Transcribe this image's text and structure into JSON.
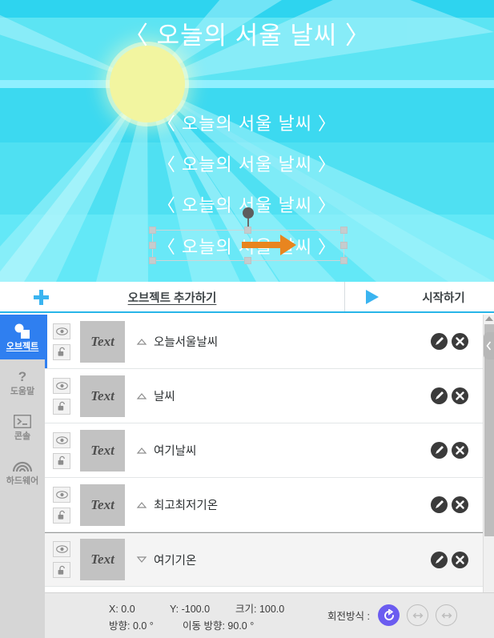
{
  "stage": {
    "title_text": "〈 오늘의 서울 날씨 〉",
    "clone_texts": [
      "〈 오늘의 서울 날씨 〉",
      "〈 오늘의 서울 날씨 〉",
      "〈 오늘의 서울 날씨 〉",
      "〈 오늘의 서울 날씨 〉"
    ],
    "sun_color": "#f2f5a0",
    "sky_color": "#45dff0",
    "direction_arrow_color": "#e8851f"
  },
  "toolbar": {
    "add_object_label": "오브젝트 추가하기",
    "start_label": "시작하기",
    "accent_color": "#3ab4f0"
  },
  "sidebar": {
    "items": [
      {
        "label": "오브젝트",
        "icon": "shapes-icon",
        "active": true
      },
      {
        "label": "도움말",
        "icon": "question-mark-icon",
        "active": false
      },
      {
        "label": "콘솔",
        "icon": "terminal-icon",
        "active": false
      },
      {
        "label": "하드웨어",
        "icon": "wifi-signal-icon",
        "active": false
      }
    ],
    "active_color": "#2f7ff0"
  },
  "object_list": {
    "thumbnail_label": "Text",
    "rows": [
      {
        "name": "오늘서울날씨",
        "expand": "collapsed-up",
        "selected": false
      },
      {
        "name": "날씨",
        "expand": "collapsed-up",
        "selected": false
      },
      {
        "name": "여기날씨",
        "expand": "collapsed-up",
        "selected": false
      },
      {
        "name": "최고최저기온",
        "expand": "collapsed-up",
        "selected": false
      },
      {
        "name": "여기기온",
        "expand": "expanded-down",
        "selected": true
      }
    ]
  },
  "status_bar": {
    "x_label": "X: 0.0",
    "y_label": "Y: -100.0",
    "size_label": "크기: 100.0",
    "direction_label": "방향: 0.0 °",
    "move_direction_label": "이동 방향: 90.0 °",
    "rotation_mode_label": "회전방식 :",
    "rotation_modes": [
      {
        "name": "free-rotation",
        "selected": true
      },
      {
        "name": "horizontal-flip-rotation",
        "selected": false
      },
      {
        "name": "fixed-rotation",
        "selected": false
      }
    ],
    "active_color": "#6b5cf0"
  }
}
